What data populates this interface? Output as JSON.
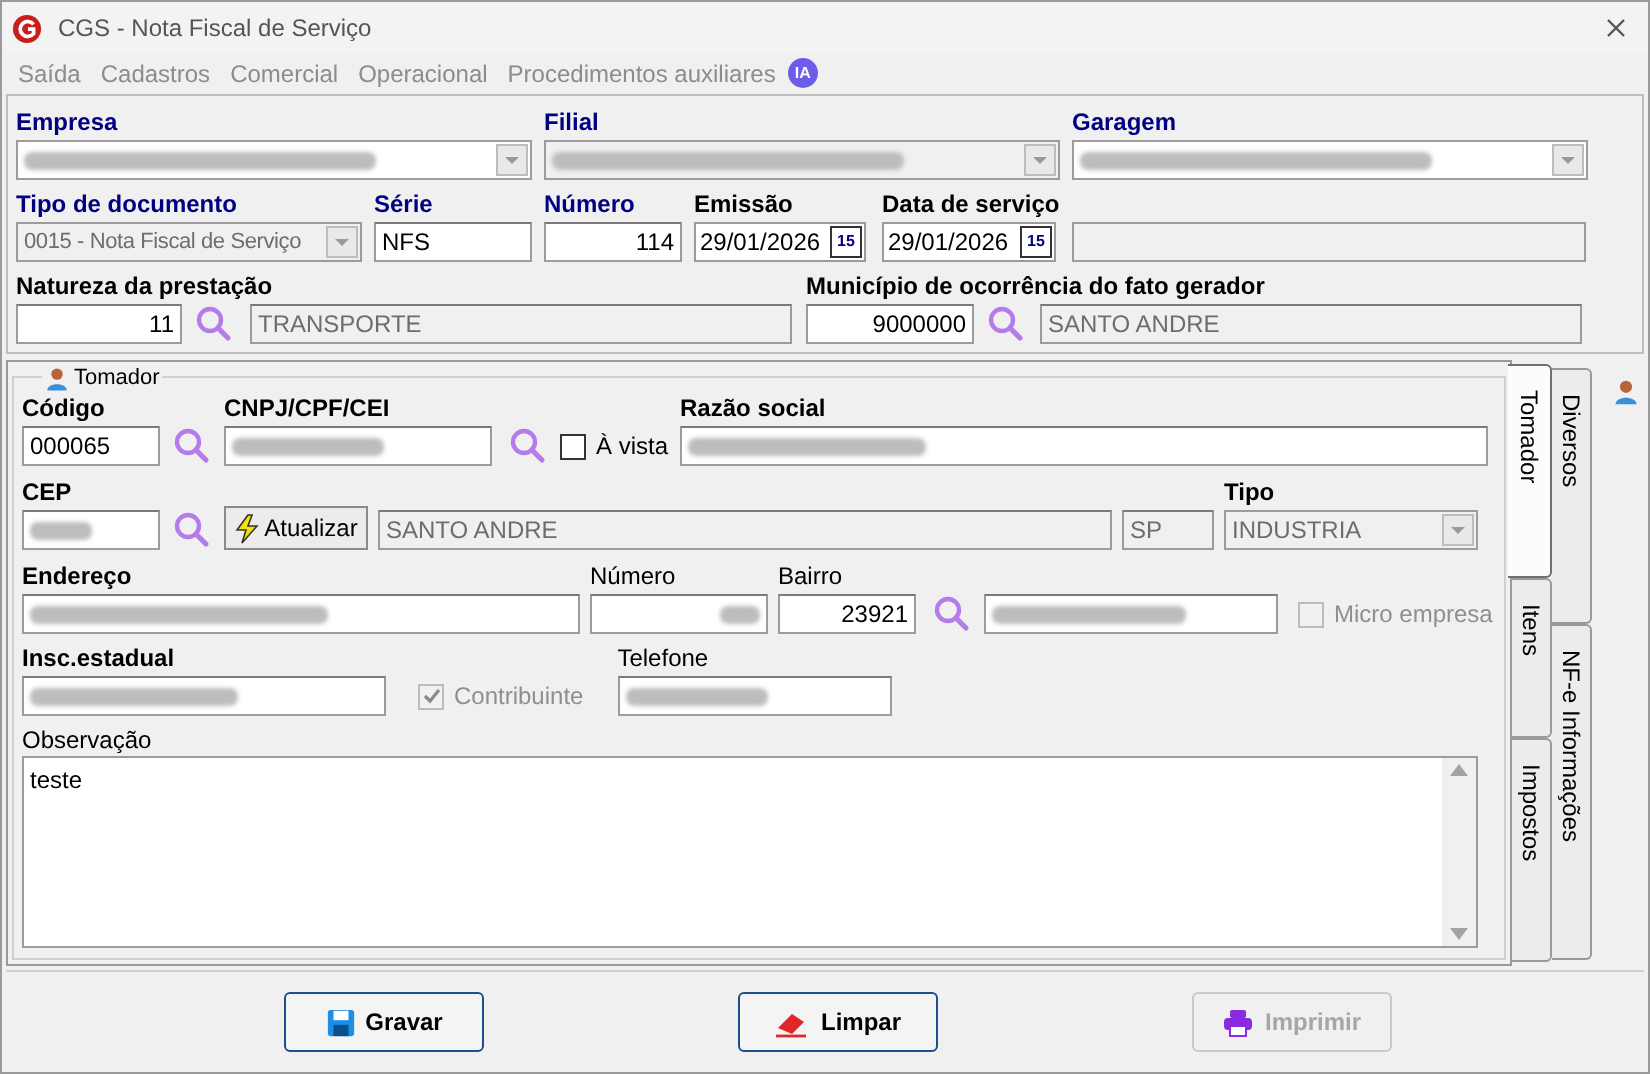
{
  "window": {
    "title": "CGS - Nota Fiscal de Serviço"
  },
  "menu": [
    "Saída",
    "Cadastros",
    "Comercial",
    "Operacional",
    "Procedimentos auxiliares"
  ],
  "ia_badge": "IA",
  "header": {
    "empresa": {
      "label": "Empresa"
    },
    "filial": {
      "label": "Filial"
    },
    "garagem": {
      "label": "Garagem"
    },
    "tipo_documento": {
      "label": "Tipo de documento",
      "value": "0015 - Nota Fiscal de Serviço"
    },
    "serie": {
      "label": "Série",
      "value": "NFS"
    },
    "numero": {
      "label": "Número",
      "value": "114"
    },
    "emissao": {
      "label": "Emissão",
      "value": "29/01/2026",
      "calendar": "15"
    },
    "data_servico": {
      "label": "Data de serviço",
      "value": "29/01/2026",
      "calendar": "15"
    },
    "natureza": {
      "label": "Natureza da prestação",
      "code": "11",
      "description": "TRANSPORTE"
    },
    "municipio": {
      "label": "Município de ocorrência do fato gerador",
      "code": "9000000",
      "description": "SANTO ANDRE"
    }
  },
  "tomador": {
    "title": "Tomador",
    "codigo": {
      "label": "Código",
      "value": "000065"
    },
    "cnpj": {
      "label": "CNPJ/CPF/CEI"
    },
    "a_vista": {
      "label": "À vista",
      "checked": false,
      "disabled": false
    },
    "razao_social": {
      "label": "Razão social"
    },
    "cep": {
      "label": "CEP"
    },
    "atualizar": "Atualizar",
    "cidade": "SANTO ANDRE",
    "uf": "SP",
    "tipo": {
      "label": "Tipo",
      "value": "INDUSTRIA"
    },
    "endereco": {
      "label": "Endereço"
    },
    "numero": {
      "label": "Número"
    },
    "bairro": {
      "label": "Bairro",
      "code": "23921"
    },
    "micro_empresa": {
      "label": "Micro empresa",
      "checked": false,
      "disabled": true
    },
    "insc_estadual": {
      "label": "Insc.estadual"
    },
    "contribuinte": {
      "label": "Contribuinte",
      "checked": true,
      "disabled": true
    },
    "telefone": {
      "label": "Telefone"
    },
    "observacao": {
      "label": "Observação",
      "value": "teste"
    }
  },
  "tabs": [
    {
      "label": "Tomador",
      "selected": true
    },
    {
      "label": "Itens",
      "selected": false
    },
    {
      "label": "Impostos",
      "selected": false
    },
    {
      "label": "Diversos",
      "selected": false
    },
    {
      "label": "NF-e Informações",
      "selected": false
    }
  ],
  "buttons": [
    {
      "label": "Gravar",
      "kind": "save",
      "disabled": false
    },
    {
      "label": "Limpar",
      "kind": "clear",
      "disabled": false
    },
    {
      "label": "Imprimir",
      "kind": "print",
      "disabled": true
    }
  ]
}
